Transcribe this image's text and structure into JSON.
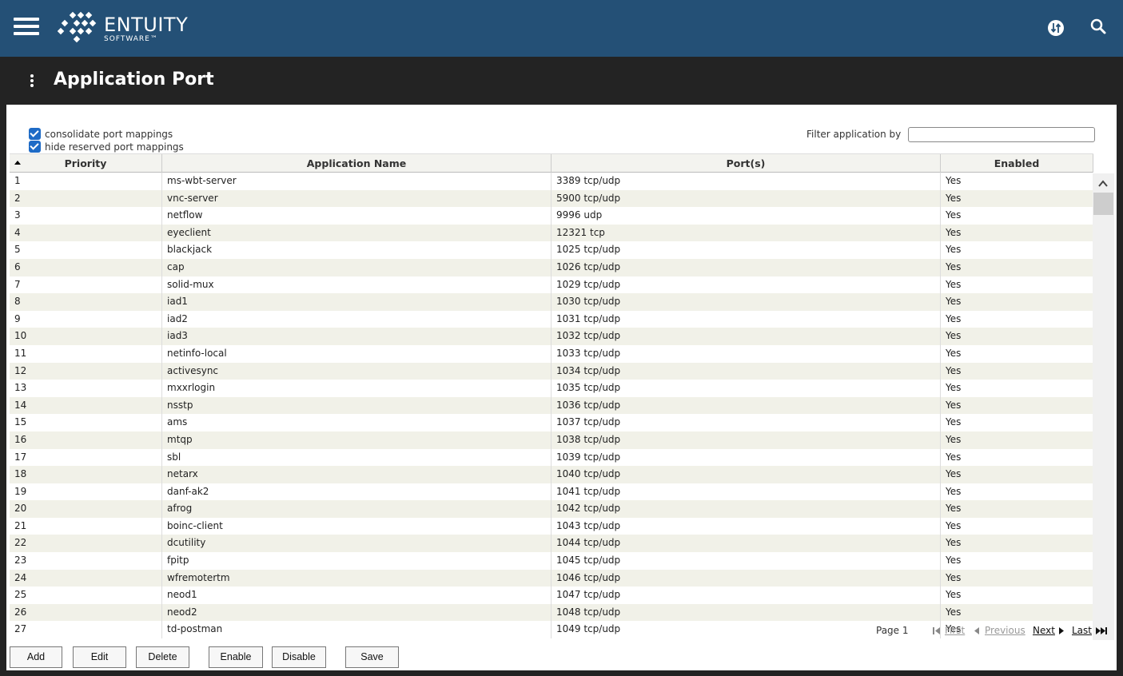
{
  "app": {
    "brand_name": "ENTUITY",
    "brand_sub": "SOFTWARE™",
    "icons": {
      "menu": "hamburger-icon",
      "switch": "switch-arrows-icon",
      "search": "search-icon"
    }
  },
  "page": {
    "title": "Application Port"
  },
  "options": {
    "consolidate_label": "consolidate port mappings",
    "consolidate_checked": true,
    "hide_reserved_label": "hide reserved port mappings",
    "hide_reserved_checked": true
  },
  "filter": {
    "label": "Filter application by",
    "value": ""
  },
  "table": {
    "headers": {
      "priority": "Priority",
      "name": "Application Name",
      "ports": "Port(s)",
      "enabled": "Enabled"
    },
    "sort": {
      "column": "priority",
      "direction": "ascending"
    },
    "rows": [
      {
        "priority": "1",
        "name": "ms-wbt-server",
        "ports": "3389 tcp/udp",
        "enabled": "Yes"
      },
      {
        "priority": "2",
        "name": "vnc-server",
        "ports": "5900 tcp/udp",
        "enabled": "Yes"
      },
      {
        "priority": "3",
        "name": "netflow",
        "ports": "9996 udp",
        "enabled": "Yes"
      },
      {
        "priority": "4",
        "name": "eyeclient",
        "ports": "12321 tcp",
        "enabled": "Yes"
      },
      {
        "priority": "5",
        "name": "blackjack",
        "ports": "1025 tcp/udp",
        "enabled": "Yes"
      },
      {
        "priority": "6",
        "name": "cap",
        "ports": "1026 tcp/udp",
        "enabled": "Yes"
      },
      {
        "priority": "7",
        "name": "solid-mux",
        "ports": "1029 tcp/udp",
        "enabled": "Yes"
      },
      {
        "priority": "8",
        "name": "iad1",
        "ports": "1030 tcp/udp",
        "enabled": "Yes"
      },
      {
        "priority": "9",
        "name": "iad2",
        "ports": "1031 tcp/udp",
        "enabled": "Yes"
      },
      {
        "priority": "10",
        "name": "iad3",
        "ports": "1032 tcp/udp",
        "enabled": "Yes"
      },
      {
        "priority": "11",
        "name": "netinfo-local",
        "ports": "1033 tcp/udp",
        "enabled": "Yes"
      },
      {
        "priority": "12",
        "name": "activesync",
        "ports": "1034 tcp/udp",
        "enabled": "Yes"
      },
      {
        "priority": "13",
        "name": "mxxrlogin",
        "ports": "1035 tcp/udp",
        "enabled": "Yes"
      },
      {
        "priority": "14",
        "name": "nsstp",
        "ports": "1036 tcp/udp",
        "enabled": "Yes"
      },
      {
        "priority": "15",
        "name": "ams",
        "ports": "1037 tcp/udp",
        "enabled": "Yes"
      },
      {
        "priority": "16",
        "name": "mtqp",
        "ports": "1038 tcp/udp",
        "enabled": "Yes"
      },
      {
        "priority": "17",
        "name": "sbl",
        "ports": "1039 tcp/udp",
        "enabled": "Yes"
      },
      {
        "priority": "18",
        "name": "netarx",
        "ports": "1040 tcp/udp",
        "enabled": "Yes"
      },
      {
        "priority": "19",
        "name": "danf-ak2",
        "ports": "1041 tcp/udp",
        "enabled": "Yes"
      },
      {
        "priority": "20",
        "name": "afrog",
        "ports": "1042 tcp/udp",
        "enabled": "Yes"
      },
      {
        "priority": "21",
        "name": "boinc-client",
        "ports": "1043 tcp/udp",
        "enabled": "Yes"
      },
      {
        "priority": "22",
        "name": "dcutility",
        "ports": "1044 tcp/udp",
        "enabled": "Yes"
      },
      {
        "priority": "23",
        "name": "fpitp",
        "ports": "1045 tcp/udp",
        "enabled": "Yes"
      },
      {
        "priority": "24",
        "name": "wfremotertm",
        "ports": "1046 tcp/udp",
        "enabled": "Yes"
      },
      {
        "priority": "25",
        "name": "neod1",
        "ports": "1047 tcp/udp",
        "enabled": "Yes"
      },
      {
        "priority": "26",
        "name": "neod2",
        "ports": "1048 tcp/udp",
        "enabled": "Yes"
      },
      {
        "priority": "27",
        "name": "td-postman",
        "ports": "1049 tcp/udp",
        "enabled": "Yes"
      }
    ]
  },
  "pager": {
    "page_text": "Page 1",
    "first": "First",
    "previous": "Previous",
    "next": "Next",
    "last": "Last"
  },
  "buttons": {
    "add": "Add",
    "edit": "Edit",
    "delete": "Delete",
    "enable": "Enable",
    "disable": "Disable",
    "save": "Save"
  },
  "colors": {
    "topbar": "#245076",
    "titlebar": "#232323",
    "checkbox": "#1e6bc6",
    "row_alt": "#f1f1e8"
  }
}
